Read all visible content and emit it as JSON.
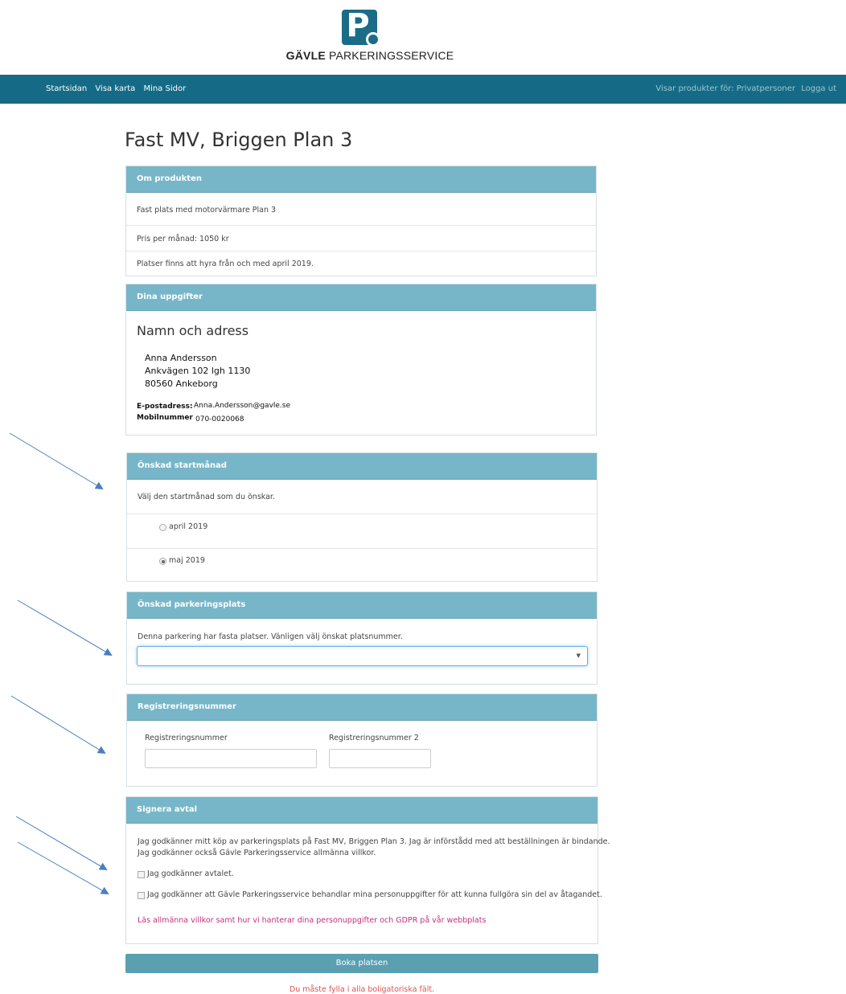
{
  "logo": {
    "letter": "P",
    "brand_bold": "GÄVLE",
    "brand_rest": " PARKERINGSSERVICE"
  },
  "nav": {
    "links": [
      "Startsidan",
      "Visa karta",
      "Mina Sidor"
    ],
    "products_for": "Visar produkter för: Privatpersoner",
    "logout": "Logga ut"
  },
  "page_title": "Fast MV, Briggen Plan 3",
  "product": {
    "heading": "Om produkten",
    "description": "Fast plats med motorvärmare Plan 3",
    "price": "Pris per månad: 1050 kr",
    "availability": "Platser finns att hyra från och med april 2019."
  },
  "details": {
    "heading": "Dina uppgifter",
    "subheading": "Namn och adress",
    "name": "Anna Andersson",
    "street": "Ankvägen 102 lgh 1130",
    "postal": "80560 Ankeborg",
    "email_label": "E-postadress:",
    "email": "Anna.Andersson@gavle.se",
    "phone_label": "Mobilnummer",
    "phone": "070-0020068"
  },
  "start_month": {
    "heading": "Önskad startmånad",
    "instruction": "Välj den startmånad som du önskar.",
    "options": [
      {
        "label": "april 2019",
        "checked": false
      },
      {
        "label": "maj 2019",
        "checked": true
      }
    ]
  },
  "parking_spot": {
    "heading": "Önskad parkeringsplats",
    "instruction": "Denna parkering har fasta platser. Vänligen välj önskat platsnummer.",
    "selected": ""
  },
  "registration": {
    "heading": "Registreringsnummer",
    "label1": "Registreringsnummer",
    "value1": "",
    "label2": "Registreringsnummer 2",
    "value2": ""
  },
  "agreement": {
    "heading": "Signera avtal",
    "text_line1": "Jag godkänner mitt köp av parkeringsplats på Fast MV, Briggen Plan 3. Jag är införstådd med att beställningen är bindande.",
    "text_line2": "Jag godkänner också Gävle Parkeringsservice allmänna villkor.",
    "checkbox1": "Jag godkänner avtalet.",
    "checkbox2": "Jag godkänner att Gävle Parkeringsservice behandlar mina personuppgifter för att kunna fullgöra sin del av åtagandet.",
    "link": "Läs allmänna villkor samt hur vi hanterar dina personuppgifter och GDPR på vår webbplats"
  },
  "book_button": "Boka platsen",
  "error": "Du måste fylla i alla boligatoriska fält.",
  "colors": {
    "nav": "#156b86",
    "panel_heading": "#77b6c9",
    "button": "#5b9fb1",
    "error": "#d9534f",
    "link": "#c2327a",
    "annotation_arrow": "#4a7fc1"
  }
}
